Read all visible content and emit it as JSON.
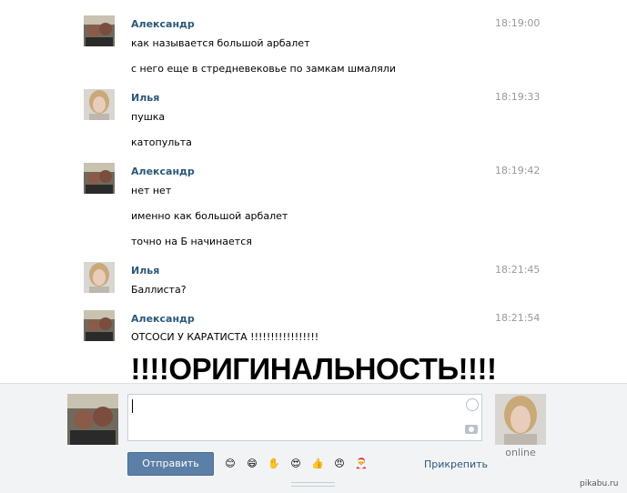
{
  "messages": [
    {
      "author": "Александр",
      "time": "18:19:00",
      "lines": [
        "как называется большой арбалет",
        "с него еще в стредневековье по замкам шмаляли"
      ]
    },
    {
      "author": "Илья",
      "time": "18:19:33",
      "lines": [
        "пушка",
        "катопульта"
      ]
    },
    {
      "author": "Александр",
      "time": "18:19:42",
      "lines": [
        "нет нет",
        "именно как большой арбалет",
        "точно на Б начинается"
      ]
    },
    {
      "author": "Илья",
      "time": "18:21:45",
      "lines": [
        "Баллиста?"
      ]
    },
    {
      "author": "Александр",
      "time": "18:21:54",
      "lines": [
        "ОТСОСИ У КАРАТИСТА !!!!!!!!!!!!!!!!!"
      ]
    }
  ],
  "caption": "!!!!ОРИГИНАЛЬНОСТЬ!!!!",
  "compose": {
    "send_label": "Отправить",
    "attach_label": "Прикрепить",
    "status": "online",
    "emojis": [
      "😊",
      "😄",
      "✋",
      "😍",
      "👍",
      "😠",
      "🎅"
    ]
  },
  "watermark": "pikabu.ru",
  "colors": {
    "link": "#2b587a",
    "button": "#5b7fa6",
    "time": "#999999"
  }
}
